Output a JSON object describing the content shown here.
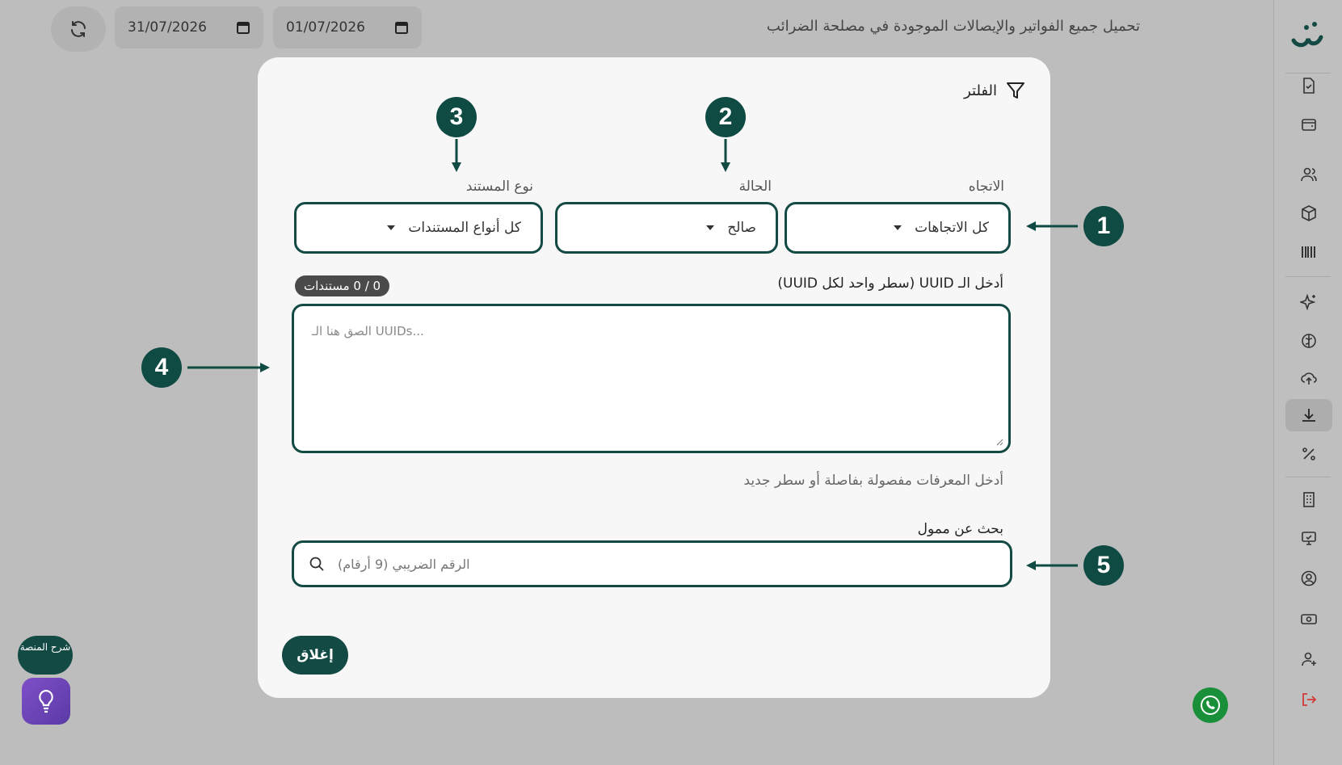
{
  "topbar": {
    "title": "تحميل جميع الفواتير والإيصالات الموجودة في مصلحة الضرائب",
    "date_from": "01/07/2026",
    "date_to": "31/07/2026"
  },
  "sidebar": {
    "icons": [
      "invoice-check-icon",
      "wallet-icon",
      "users-icon",
      "package-icon",
      "barcode-icon",
      "sparkles-icon",
      "brain-icon",
      "cloud-upload-icon",
      "download-icon",
      "percent-icon",
      "building-icon",
      "monitor-icon",
      "user-circle-icon",
      "cash-icon",
      "user-plus-icon",
      "logout-icon"
    ],
    "active": "download-icon"
  },
  "helper": {
    "guide_label": "شرح المنصة",
    "bulb_icon": "lightbulb-icon",
    "whatsapp_icon": "whatsapp-icon"
  },
  "modal": {
    "title": "الفلتر",
    "direction_label": "الاتجاه",
    "direction_value": "كل الاتجاهات",
    "status_label": "الحالة",
    "status_value": "صالح",
    "doctype_label": "نوع المستند",
    "doctype_value": "كل أنواع المستندات",
    "uuid_label": "أدخل الـ UUID (سطر واحد لكل UUID)",
    "doc_count": "0 / 0 مستندات",
    "uuid_placeholder": "الصق هنا الـ UUIDs...",
    "hint": "أدخل المعرفات مفصولة بفاصلة أو سطر جديد",
    "search_label": "بحث عن ممول",
    "search_placeholder": "الرقم الضريبي (9 أرقام)",
    "close_label": "إغلاق"
  },
  "callouts": [
    "1",
    "2",
    "3",
    "4",
    "5"
  ],
  "colors": {
    "accent": "#134a44",
    "overlay": "#bdbdbd",
    "danger": "#d33a3a"
  }
}
